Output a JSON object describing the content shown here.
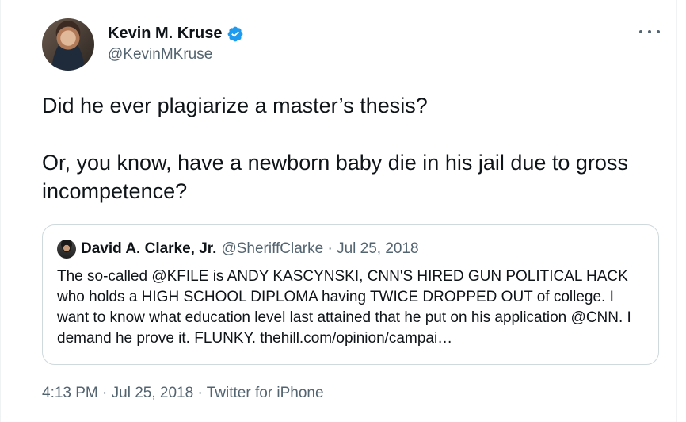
{
  "author": {
    "name": "Kevin M. Kruse",
    "handle": "@KevinMKruse",
    "verified": true
  },
  "tweet": {
    "paragraphs": [
      "Did he ever plagiarize a master’s thesis?",
      "Or, you know, have a newborn baby die in his jail due to gross incompetence?"
    ]
  },
  "quoted_tweet": {
    "name": "David A. Clarke, Jr.",
    "meta": "@SheriffClarke · Jul 25, 2018",
    "text": "The so-called @KFILE is ANDY KASCYNSKI, CNN'S HIRED GUN POLITICAL HACK who holds a HIGH SCHOOL DIPLOMA having TWICE DROPPED OUT of college. I want to know what education level last attained that he put on his application @CNN. I demand he prove it. FLUNKY. thehill.com/opinion/campai…"
  },
  "footer": {
    "timestamp": "4:13 PM · Jul 25, 2018 · Twitter for iPhone"
  },
  "icons": {
    "verified": "verified-badge-icon",
    "more": "more-options-icon"
  },
  "colors": {
    "verified": "#1d9bf0",
    "secondary_text": "#536471",
    "border": "#cfd9de"
  }
}
